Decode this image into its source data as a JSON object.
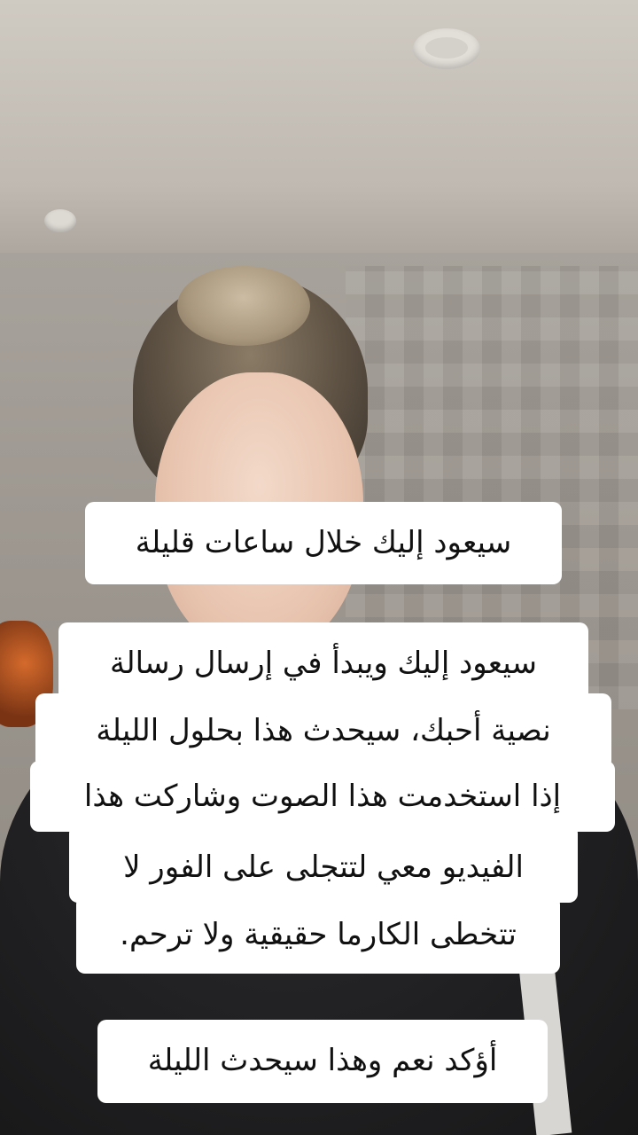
{
  "captions": [
    {
      "lines": [
        "سيعود إليك خلال ساعات قليلة"
      ]
    },
    {
      "lines": [
        "سيعود إليك ويبدأ في إرسال رسالة",
        "نصية أحبك، سيحدث هذا بحلول الليلة",
        "إذا استخدمت هذا الصوت وشاركت هذا",
        "الفيديو معي لتتجلى على الفور لا",
        "تتخطى الكارما حقيقية ولا ترحم."
      ]
    },
    {
      "lines": [
        "أؤكد نعم وهذا سيحدث الليلة"
      ]
    }
  ]
}
